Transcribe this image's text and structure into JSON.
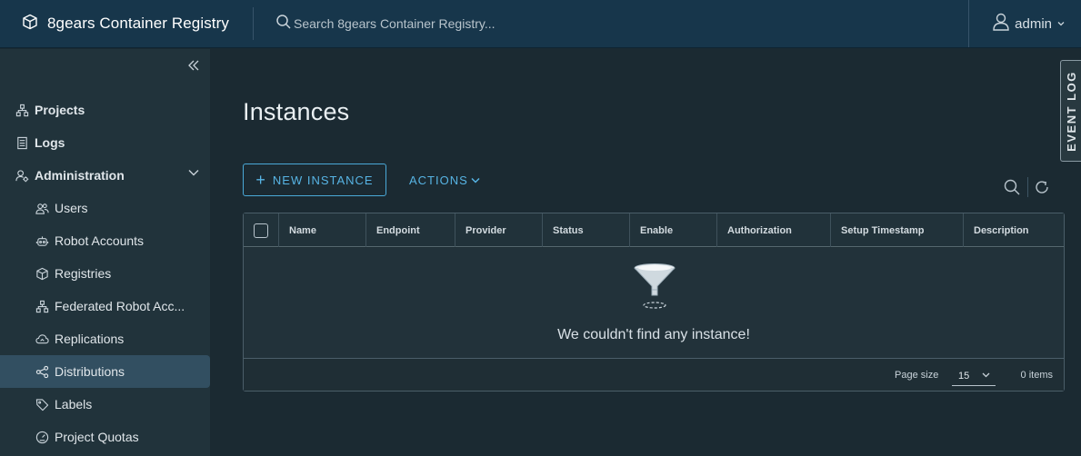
{
  "header": {
    "brand_title": "8gears Container Registry",
    "search_placeholder": "Search 8gears Container Registry...",
    "user_name": "admin"
  },
  "sidebar": {
    "items": [
      {
        "label": "Projects",
        "icon": "projects-icon",
        "level": "top"
      },
      {
        "label": "Logs",
        "icon": "logs-icon",
        "level": "top"
      },
      {
        "label": "Administration",
        "icon": "administration-icon",
        "level": "top",
        "expanded": true
      },
      {
        "label": "Users",
        "icon": "users-icon",
        "level": "sub"
      },
      {
        "label": "Robot Accounts",
        "icon": "robot-icon",
        "level": "sub"
      },
      {
        "label": "Registries",
        "icon": "registries-icon",
        "level": "sub"
      },
      {
        "label": "Federated Robot Acc...",
        "icon": "federated-icon",
        "level": "sub"
      },
      {
        "label": "Replications",
        "icon": "replications-icon",
        "level": "sub"
      },
      {
        "label": "Distributions",
        "icon": "distributions-icon",
        "level": "sub",
        "active": true
      },
      {
        "label": "Labels",
        "icon": "labels-icon",
        "level": "sub"
      },
      {
        "label": "Project Quotas",
        "icon": "quotas-icon",
        "level": "sub"
      }
    ]
  },
  "main": {
    "title": "Instances",
    "new_button_label": "NEW INSTANCE",
    "actions_label": "ACTIONS",
    "table": {
      "columns": [
        "Name",
        "Endpoint",
        "Provider",
        "Status",
        "Enable",
        "Authorization",
        "Setup Timestamp",
        "Description"
      ],
      "empty_message": "We couldn't find any instance!",
      "page_size_label": "Page size",
      "page_size_value": "15",
      "items_count": "0 items"
    }
  },
  "event_log_label": "EVENT LOG",
  "colors": {
    "header_bg": "#17364b",
    "sidebar_bg": "#21333b",
    "main_bg": "#1b2a32",
    "accent": "#57b4e4",
    "active_item_bg": "#324f61"
  }
}
